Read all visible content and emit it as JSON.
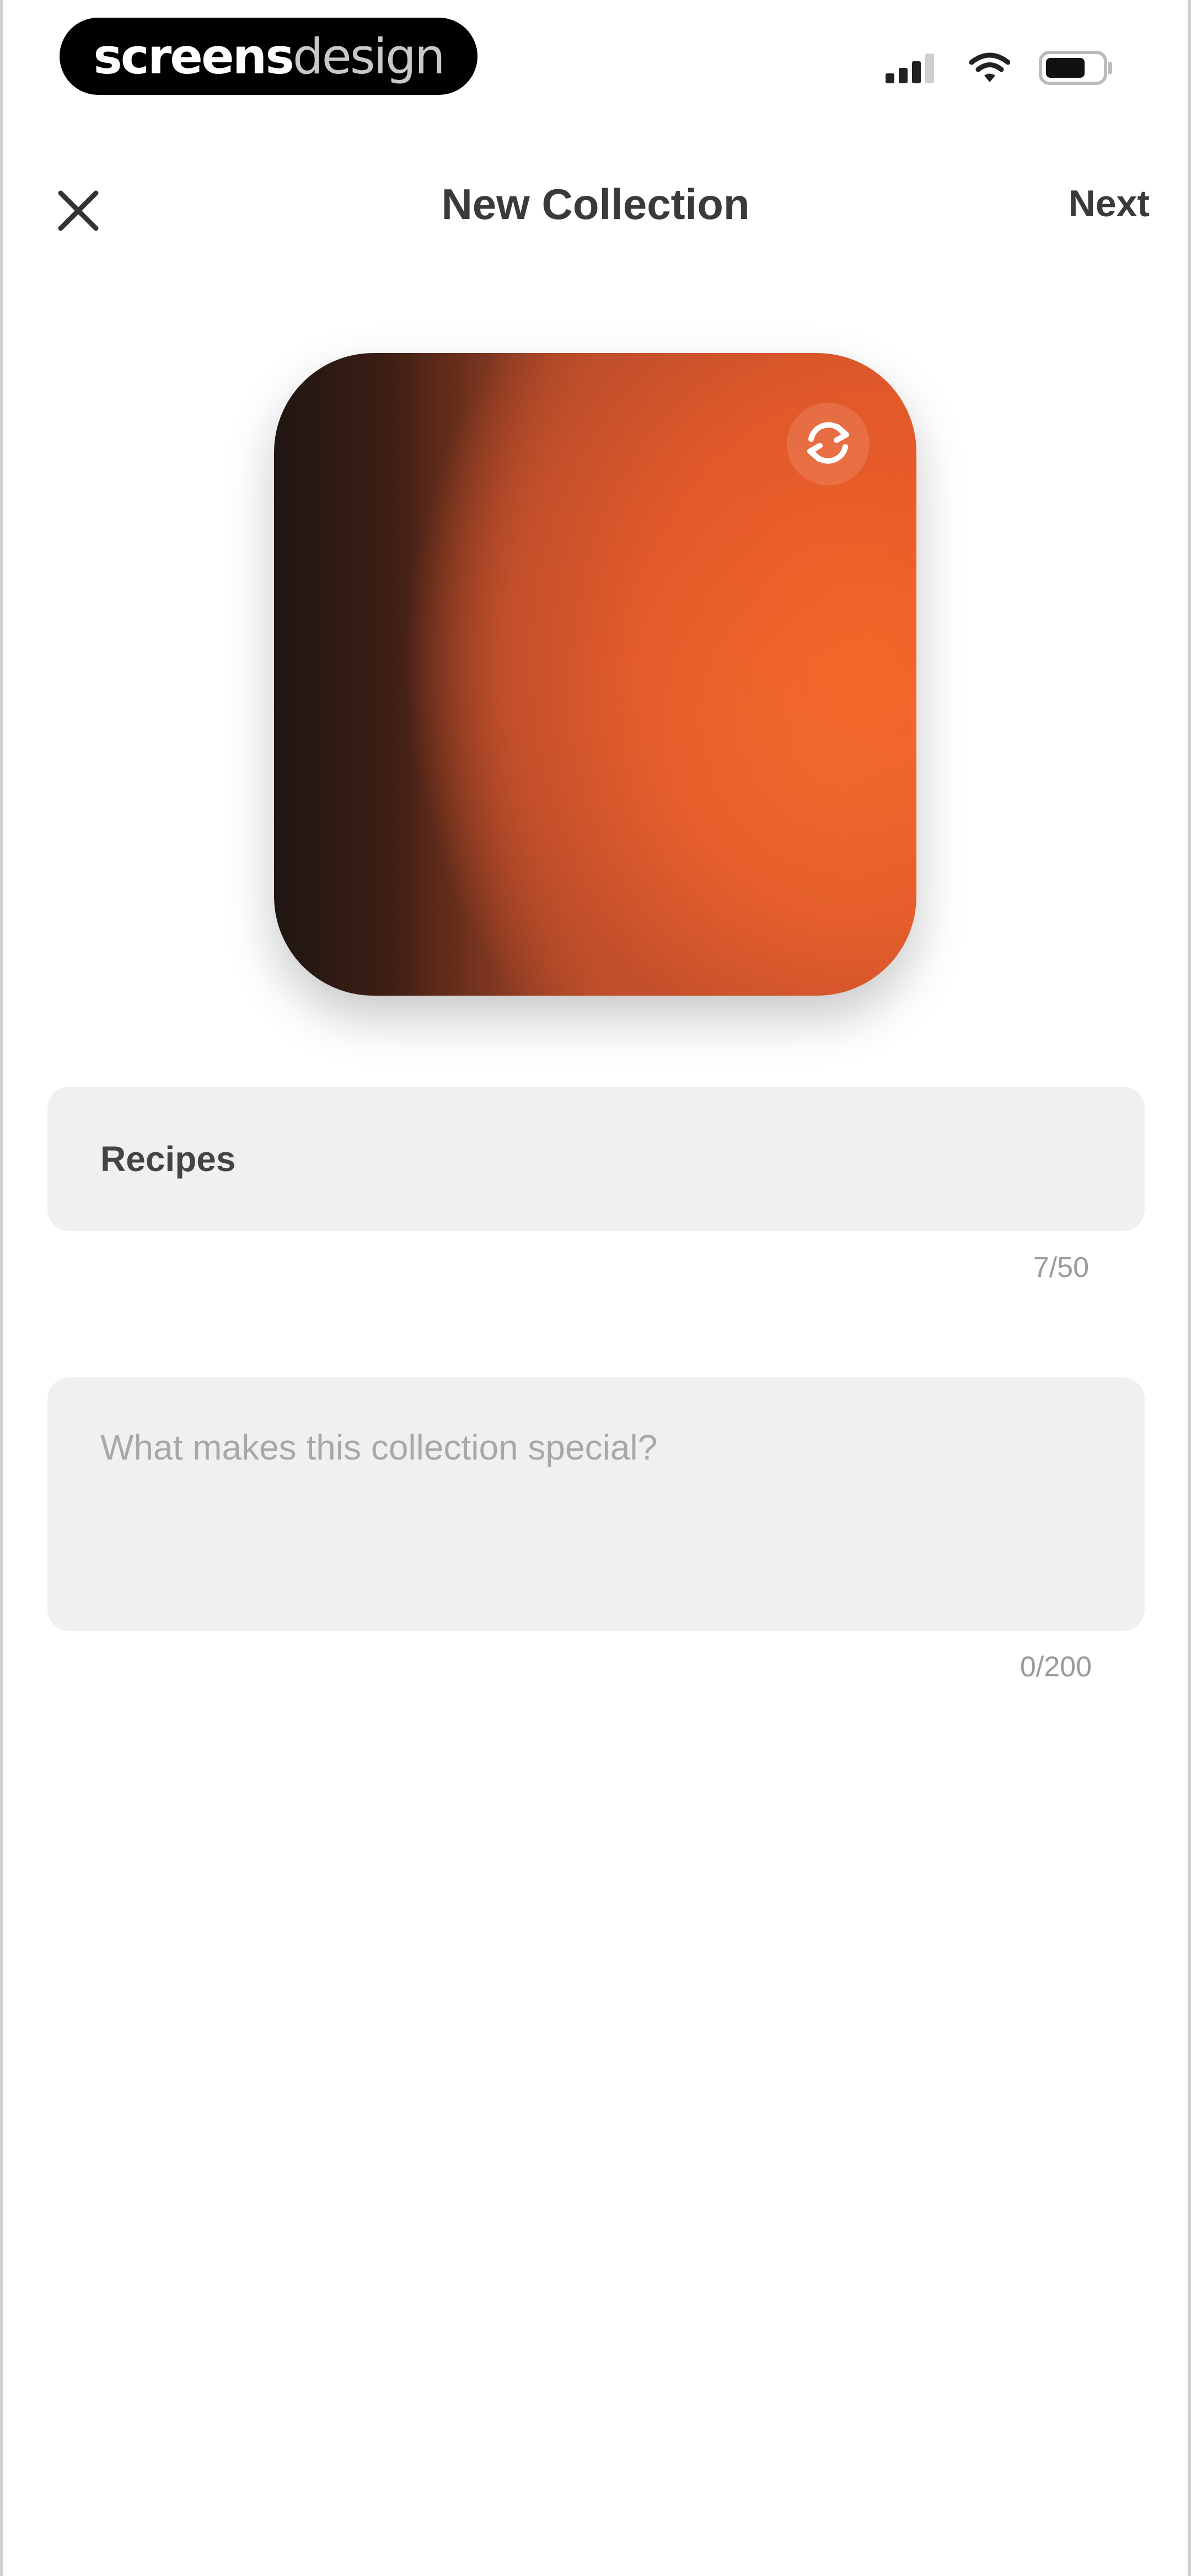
{
  "status_bar": {
    "brand_bold": "screens",
    "brand_light": "design"
  },
  "header": {
    "title": "New Collection",
    "next_label": "Next"
  },
  "cover": {
    "colors": [
      "#1e1612",
      "#873a21",
      "#e2592a",
      "#f25f25"
    ]
  },
  "name_field": {
    "value": "Recipes",
    "counter": "7/50"
  },
  "description_field": {
    "placeholder": "What makes this collection special?",
    "counter": "0/200"
  },
  "icons": [
    "close-icon",
    "refresh-icon",
    "cellular-signal-icon",
    "wifi-icon",
    "battery-icon"
  ]
}
